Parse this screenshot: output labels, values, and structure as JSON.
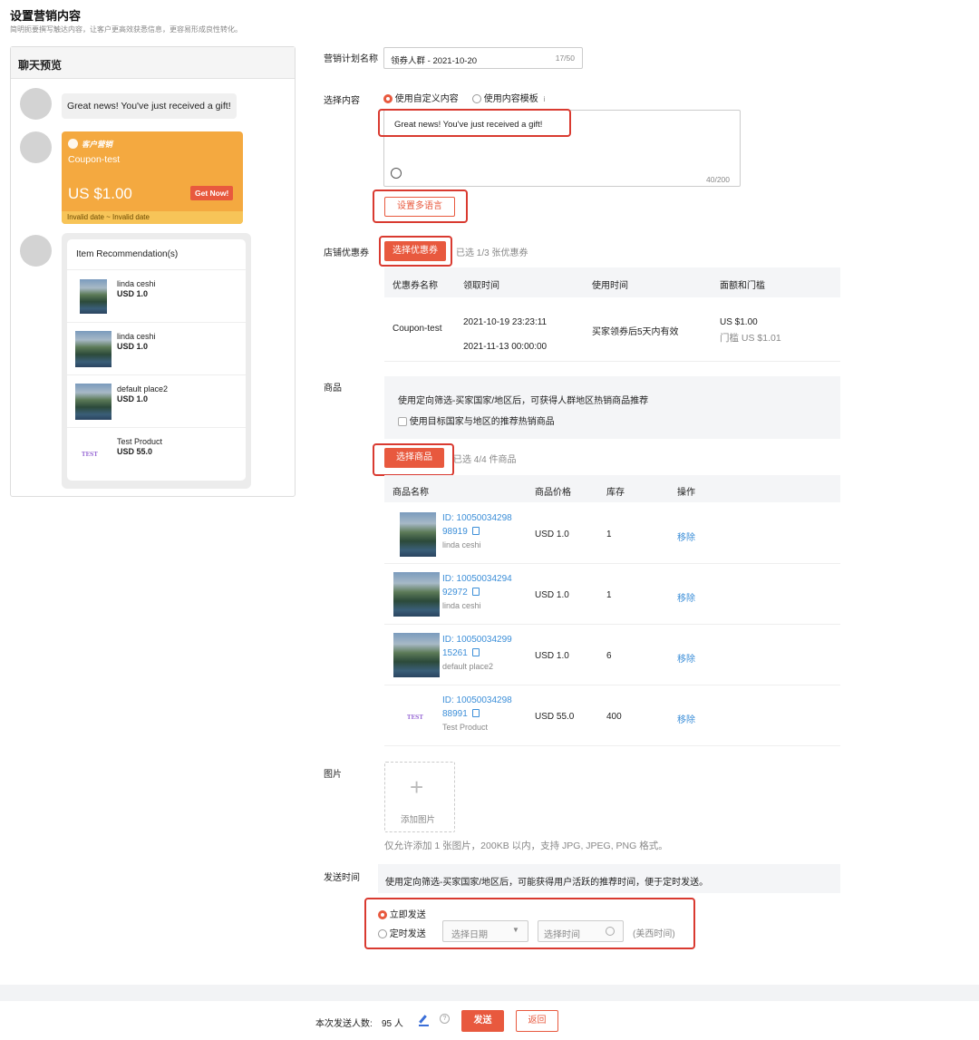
{
  "page": {
    "title": "设置营销内容",
    "subtitle": "简明扼要撰写触达内容，让客户更高效获悉信息，更容易形成良性转化。"
  },
  "preview": {
    "header": "聊天预览",
    "message": "Great news! You've just received a gift!",
    "coupon": {
      "badge": "客户营销",
      "name": "Coupon-test",
      "amount": "US $1.00",
      "cta": "Get Now!",
      "validity": "Invalid date ~ Invalid date"
    },
    "recommendation": {
      "title": "Item Recommendation(s)",
      "items": [
        {
          "name": "linda ceshi",
          "price": "USD 1.0"
        },
        {
          "name": "linda ceshi",
          "price": "USD 1.0"
        },
        {
          "name": "default place2",
          "price": "USD 1.0"
        },
        {
          "name": "Test Product",
          "price": "USD 55.0",
          "thumb_text": "TEST"
        }
      ]
    }
  },
  "form": {
    "plan_name": {
      "label": "营销计划名称",
      "value": "领券人群 - 2021-10-20",
      "count": "17/50"
    },
    "content": {
      "label": "选择内容",
      "option_custom": "使用自定义内容",
      "option_template": "使用内容模板",
      "info_icon": "i",
      "text": "Great news! You've just received a gift!",
      "count": "40/200",
      "multilang_button": "设置多语言"
    },
    "coupon": {
      "label": "店铺优惠券",
      "select_button": "选择优惠券",
      "selected_text": "已选 1/3 张优惠券",
      "columns": [
        "优惠券名称",
        "领取时间",
        "使用时间",
        "面额和门槛"
      ],
      "rows": [
        {
          "name": "Coupon-test",
          "claim_start": "2021-10-19 23:23:11",
          "claim_end": "2021-11-13 00:00:00",
          "use_time": "买家领券后5天内有效",
          "face_value": "US $1.00",
          "threshold": "门槛 US $1.01"
        }
      ]
    },
    "products": {
      "label": "商品",
      "notice": "使用定向筛选-买家国家/地区后，可获得人群地区热销商品推荐",
      "checkbox_label": "使用目标国家与地区的推荐热销商品",
      "select_button": "选择商品",
      "selected_text": "已选 4/4 件商品",
      "columns": [
        "商品名称",
        "商品价格",
        "库存",
        "操作"
      ],
      "rows": [
        {
          "id_line1": "ID: 10050034298",
          "id_line2": "98919",
          "name": "linda ceshi",
          "price": "USD 1.0",
          "stock": "1",
          "action": "移除"
        },
        {
          "id_line1": "ID: 10050034294",
          "id_line2": "92972",
          "name": "linda ceshi",
          "price": "USD 1.0",
          "stock": "1",
          "action": "移除"
        },
        {
          "id_line1": "ID: 10050034299",
          "id_line2": "15261",
          "name": "default place2",
          "price": "USD 1.0",
          "stock": "6",
          "action": "移除"
        },
        {
          "id_line1": "ID: 10050034298",
          "id_line2": "88991",
          "name": "Test Product",
          "price": "USD 55.0",
          "stock": "400",
          "action": "移除",
          "thumb_text": "TEST"
        }
      ]
    },
    "image": {
      "label": "图片",
      "upload_label": "添加图片",
      "hint": "仅允许添加 1 张图片，200KB 以内，支持 JPG, JPEG, PNG 格式。"
    },
    "send_time": {
      "label": "发送时间",
      "notice": "使用定向筛选-买家国家/地区后，可能获得用户活跃的推荐时间，便于定时发送。",
      "option_now": "立即发送",
      "option_scheduled": "定时发送",
      "date_placeholder": "选择日期",
      "time_placeholder": "选择时间",
      "timezone": "(美西时间)"
    }
  },
  "footer": {
    "audience_label": "本次发送人数:",
    "audience_count": "95 人",
    "send_button": "发送",
    "back_button": "返回"
  },
  "colors": {
    "accent": "#e8593e",
    "highlight_box": "#d93a30",
    "link": "#3b8ed8",
    "coupon": "#f4a940"
  }
}
